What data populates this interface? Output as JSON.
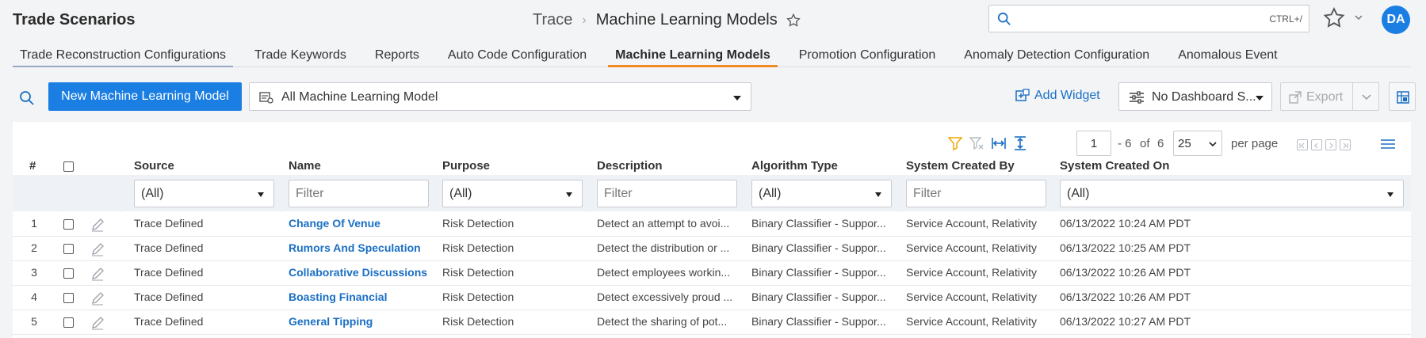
{
  "header": {
    "app_title": "Trade Scenarios",
    "breadcrumb_root": "Trace",
    "breadcrumb_current": "Machine Learning Models",
    "search_placeholder": "",
    "search_shortcut": "CTRL+/",
    "avatar_initials": "DA"
  },
  "tabs": [
    {
      "label": "Trade Reconstruction Configurations",
      "state": "first"
    },
    {
      "label": "Trade Keywords"
    },
    {
      "label": "Reports"
    },
    {
      "label": "Auto Code Configuration"
    },
    {
      "label": "Machine Learning Models",
      "state": "active"
    },
    {
      "label": "Promotion Configuration"
    },
    {
      "label": "Anomaly Detection Configuration"
    },
    {
      "label": "Anomalous Event"
    }
  ],
  "toolbar": {
    "new_button_label": "New Machine Learning Model",
    "view_select_value": "All Machine Learning Model",
    "add_widget_label": "Add Widget",
    "dashboard_select_value": "No Dashboard S...",
    "export_label": "Export"
  },
  "pager": {
    "current_page": "1",
    "range_text": "- 6",
    "of_label": "of",
    "total": "6",
    "per_page_value": "25",
    "per_page_label": "per page"
  },
  "grid": {
    "columns": {
      "num": "#",
      "source": "Source",
      "name": "Name",
      "purpose": "Purpose",
      "description": "Description",
      "algorithm": "Algorithm Type",
      "created_by": "System Created By",
      "created_on": "System Created On"
    },
    "filters": {
      "source": "(All)",
      "name": "Filter",
      "purpose": "(All)",
      "description": "Filter",
      "algorithm": "(All)",
      "created_by": "Filter",
      "created_on": "(All)"
    },
    "rows": [
      {
        "num": "1",
        "source": "Trace Defined",
        "name": "Change Of Venue",
        "purpose": "Risk Detection",
        "description": "Detect an attempt to avoi...",
        "algorithm": "Binary Classifier - Suppor...",
        "created_by": "Service Account, Relativity",
        "created_on": "06/13/2022 10:24 AM PDT"
      },
      {
        "num": "2",
        "source": "Trace Defined",
        "name": "Rumors And Speculation",
        "purpose": "Risk Detection",
        "description": "Detect the distribution or ...",
        "algorithm": "Binary Classifier - Suppor...",
        "created_by": "Service Account, Relativity",
        "created_on": "06/13/2022 10:25 AM PDT"
      },
      {
        "num": "3",
        "source": "Trace Defined",
        "name": "Collaborative Discussions",
        "purpose": "Risk Detection",
        "description": "Detect employees workin...",
        "algorithm": "Binary Classifier - Suppor...",
        "created_by": "Service Account, Relativity",
        "created_on": "06/13/2022 10:26 AM PDT"
      },
      {
        "num": "4",
        "source": "Trace Defined",
        "name": "Boasting Financial",
        "purpose": "Risk Detection",
        "description": "Detect excessively proud ...",
        "algorithm": "Binary Classifier - Suppor...",
        "created_by": "Service Account, Relativity",
        "created_on": "06/13/2022 10:26 AM PDT"
      },
      {
        "num": "5",
        "source": "Trace Defined",
        "name": "General Tipping",
        "purpose": "Risk Detection",
        "description": "Detect the sharing of pot...",
        "algorithm": "Binary Classifier - Suppor...",
        "created_by": "Service Account, Relativity",
        "created_on": "06/13/2022 10:27 AM PDT"
      }
    ]
  },
  "colors": {
    "accent": "#1a7ee3",
    "link": "#1a6fc4",
    "active_tab_underline": "#f08a24",
    "filter_icon": "#f0a500"
  }
}
